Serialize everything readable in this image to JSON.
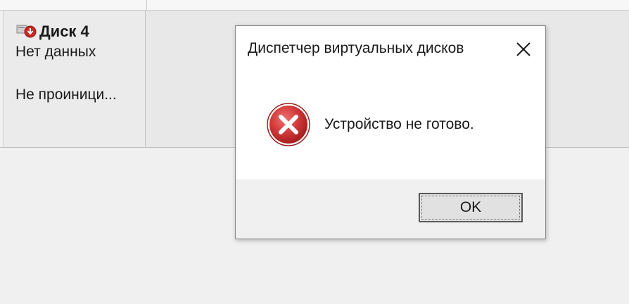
{
  "disk_panel": {
    "title": "Диск 4",
    "line1": "Нет данных",
    "line2": "Не проиници...",
    "icon": "disk-error-icon"
  },
  "dialog": {
    "title": "Диспетчер виртуальных дисков",
    "message": "Устройство не готово.",
    "ok_label": "OK",
    "close_icon": "close-icon",
    "status_icon": "error-icon"
  },
  "colors": {
    "error_red": "#c62828",
    "dialog_footer": "#f0f0f0",
    "button_border": "#5a5a5a"
  }
}
